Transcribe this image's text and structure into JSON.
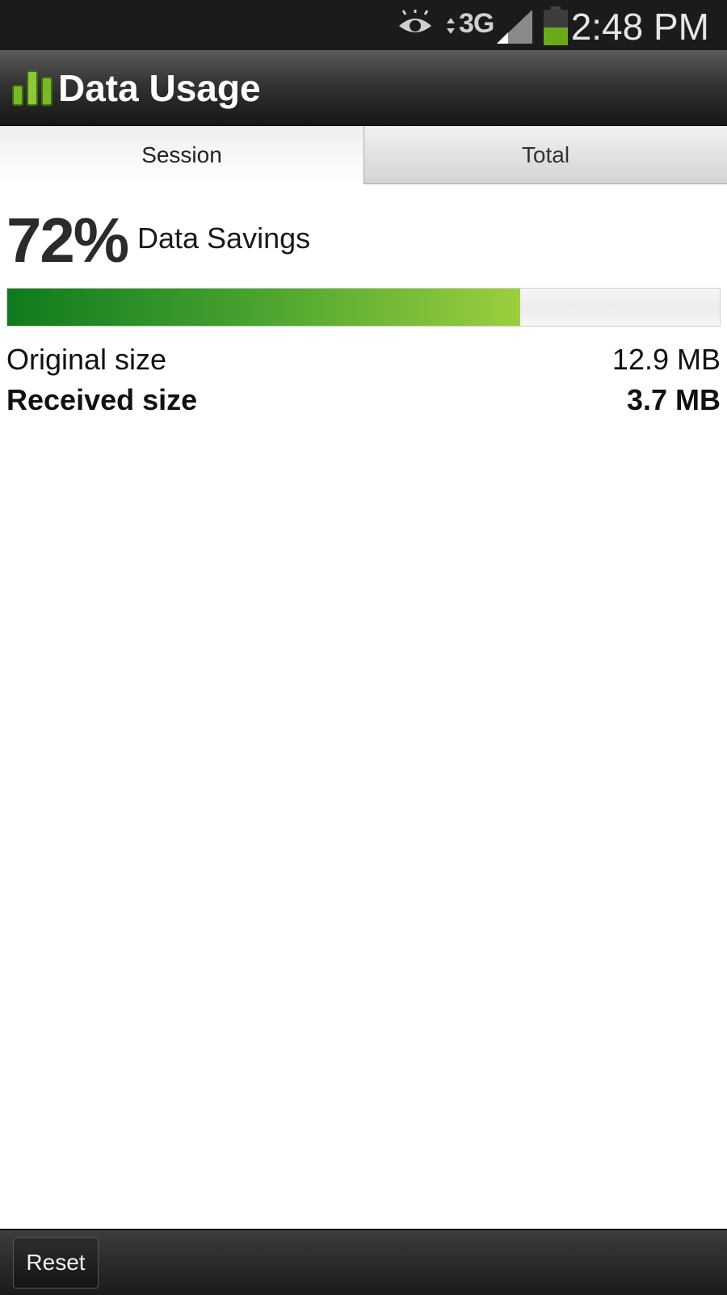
{
  "status_bar": {
    "network": "3G",
    "time": "2:48 PM",
    "icons": [
      "eye-icon",
      "network-arrows-icon",
      "signal-icon",
      "battery-icon"
    ],
    "battery_color": "#6aa81c"
  },
  "app": {
    "title": "Data Usage",
    "icon": "bar-chart-icon",
    "icon_color": "#7ab82a"
  },
  "tabs": [
    {
      "label": "Session",
      "selected": true
    },
    {
      "label": "Total",
      "selected": false
    }
  ],
  "savings": {
    "percent_text": "72%",
    "percent_value": 72,
    "label": "Data Savings",
    "bar_fill_fraction": 0.72,
    "bar_colors": [
      "#0f7a1e",
      "#9ccf3e"
    ]
  },
  "stats": {
    "original": {
      "label": "Original size",
      "value": "12.9 MB"
    },
    "received": {
      "label": "Received size",
      "value": "3.7 MB"
    }
  },
  "footer": {
    "reset_label": "Reset"
  }
}
